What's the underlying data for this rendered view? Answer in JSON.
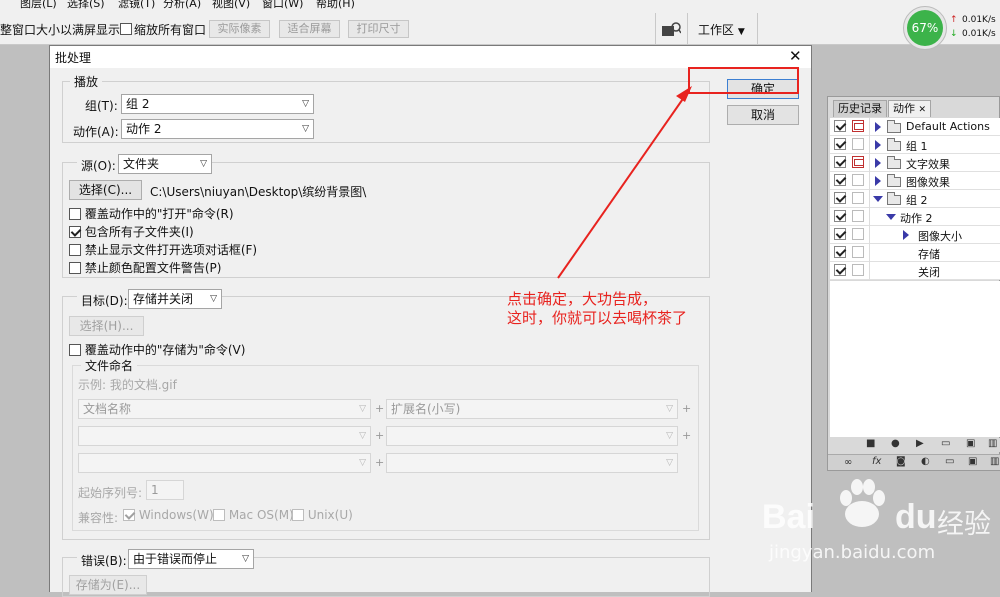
{
  "menubar": {
    "items": [
      "图层(L)",
      "选择(S)",
      "滤镜(T)",
      "分析(A)",
      "视图(V)",
      "窗口(W)",
      "帮助(H)"
    ]
  },
  "optionsbar": {
    "resize_windows_label": "整窗口大小以满屏显示",
    "zoom_all_label": "缩放所有窗口",
    "actual_pixels": "实际像素",
    "fit_screen": "适合屏幕",
    "print_size": "打印尺寸",
    "workspace": "工作区",
    "cpu_percent": "67%",
    "net_up": "0.01K/s",
    "net_down": "0.01K/s"
  },
  "dialog": {
    "title": "批处理",
    "close": "✕",
    "ok": "确定",
    "cancel": "取消",
    "play": {
      "legend": "播放",
      "set_label": "组(T):",
      "set_value": "组 2",
      "action_label": "动作(A):",
      "action_value": "动作 2"
    },
    "source": {
      "label": "源(O):",
      "value": "文件夹",
      "choose": "选择(C)...",
      "path": "C:\\Users\\niuyan\\Desktop\\缤纷背景图\\",
      "options": [
        {
          "label": "覆盖动作中的\"打开\"命令(R)",
          "checked": false
        },
        {
          "label": "包含所有子文件夹(I)",
          "checked": true
        },
        {
          "label": "禁止显示文件打开选项对话框(F)",
          "checked": false
        },
        {
          "label": "禁止颜色配置文件警告(P)",
          "checked": false
        }
      ]
    },
    "destination": {
      "label": "目标(D):",
      "value": "存储并关闭",
      "choose": "选择(H)...",
      "override_label": "覆盖动作中的\"存储为\"命令(V)",
      "naming": {
        "legend": "文件命名",
        "example": "示例: 我的文档.gif",
        "fields": [
          [
            "文档名称",
            "扩展名(小写)"
          ],
          [
            "",
            ""
          ],
          [
            "",
            ""
          ]
        ],
        "plus": "+",
        "serial_label": "起始序列号:",
        "serial_value": "1",
        "compat_label": "兼容性:",
        "compat": [
          {
            "label": "Windows(W)",
            "checked": true
          },
          {
            "label": "Mac OS(M)",
            "checked": false
          },
          {
            "label": "Unix(U)",
            "checked": false
          }
        ]
      }
    },
    "errors": {
      "label": "错误(B):",
      "value": "由于错误而停止",
      "save_as": "存储为(E)..."
    }
  },
  "annotation": {
    "line1": "点击确定，大功告成，",
    "line2": "这时，你就可以去喝杯茶了",
    "color": "#e8231f"
  },
  "panel": {
    "tabs": [
      "历史记录",
      "动作"
    ],
    "tab_close": "✕",
    "rows": [
      {
        "label": "Default Actions",
        "checked": true
      },
      {
        "label": "组 1",
        "checked": true
      },
      {
        "label": "文字效果",
        "checked": true
      },
      {
        "label": "图像效果",
        "checked": true
      },
      {
        "label": "组 2",
        "checked": true
      },
      {
        "label": "动作 2",
        "checked": true
      },
      {
        "label": "图像大小",
        "checked": true
      },
      {
        "label": "存储",
        "checked": true
      },
      {
        "label": "关闭",
        "checked": true
      }
    ]
  },
  "watermark": {
    "brand": "Bai",
    "brand2": "du",
    "cn": "经验",
    "url": "jingyan.baidu.com"
  }
}
